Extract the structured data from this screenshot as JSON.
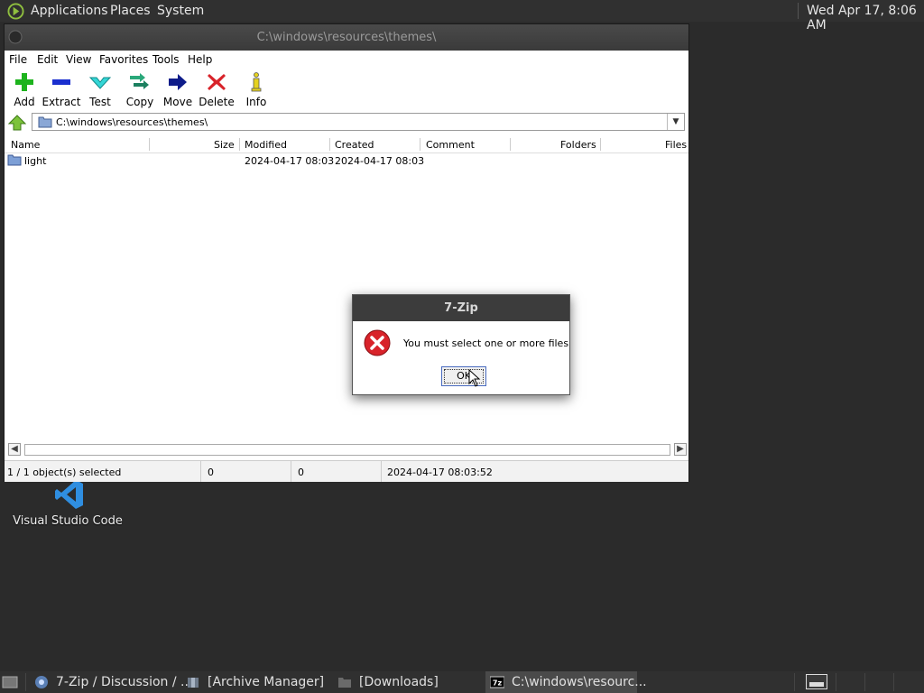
{
  "top_panel": {
    "menus": [
      "Applications",
      "Places",
      "System"
    ],
    "clock": "Wed Apr 17,  8:06 AM"
  },
  "desktop": {
    "icons": [
      {
        "label": "Visual Studio Code"
      }
    ]
  },
  "window": {
    "title": "C:\\windows\\resources\\themes\\",
    "menu": [
      "File",
      "Edit",
      "View",
      "Favorites",
      "Tools",
      "Help"
    ],
    "toolbar": [
      {
        "label": "Add",
        "icon": "plus-icon"
      },
      {
        "label": "Extract",
        "icon": "minus-icon"
      },
      {
        "label": "Test",
        "icon": "check-icon"
      },
      {
        "label": "Copy",
        "icon": "double-arrow-icon"
      },
      {
        "label": "Move",
        "icon": "arrow-right-icon"
      },
      {
        "label": "Delete",
        "icon": "x-icon"
      },
      {
        "label": "Info",
        "icon": "info-icon"
      }
    ],
    "address": "C:\\windows\\resources\\themes\\",
    "columns": [
      "Name",
      "Size",
      "Modified",
      "Created",
      "Comment",
      "Folders",
      "Files"
    ],
    "rows": [
      {
        "name": "light",
        "size": "",
        "modified": "2024-04-17 08:03",
        "created": "2024-04-17 08:03",
        "comment": "",
        "folders": "",
        "files": ""
      }
    ],
    "status": {
      "selected": "1 / 1 object(s) selected",
      "size": "0",
      "packed": "0",
      "date": "2024-04-17 08:03:52"
    }
  },
  "dialog": {
    "title": "7-Zip",
    "message": "You must select one or more files",
    "ok_label": "OK"
  },
  "taskbar": {
    "tasks": [
      {
        "label": "7-Zip / Discussion / ...",
        "active": false
      },
      {
        "label": "[Archive Manager]",
        "active": false
      },
      {
        "label": "[Downloads]",
        "active": false
      },
      {
        "label": "C:\\windows\\resourc...",
        "active": true
      }
    ]
  },
  "colors": {
    "panel_bg": "#303030",
    "desktop_bg": "#2b2b2b",
    "error_red": "#d8232a",
    "add_green": "#1db31d",
    "extract_blue": "#1a2fcf"
  }
}
